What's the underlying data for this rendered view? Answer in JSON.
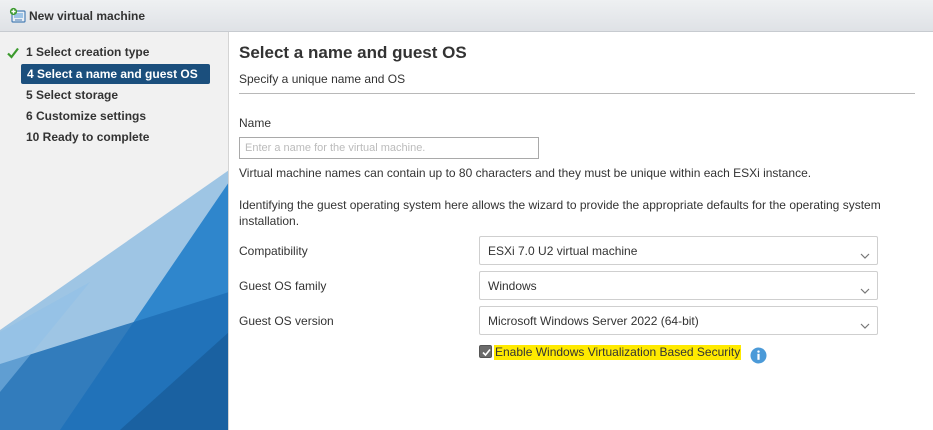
{
  "window": {
    "title": "New virtual machine",
    "icon": "vm-add-icon"
  },
  "steps": [
    {
      "label": "1  Select creation type",
      "state": "done"
    },
    {
      "label": "4  Select a name and guest OS",
      "state": "active"
    },
    {
      "label": "5  Select storage",
      "state": "pending"
    },
    {
      "label": "6  Customize settings",
      "state": "pending"
    },
    {
      "label": "10  Ready to complete",
      "state": "pending"
    }
  ],
  "main": {
    "title": "Select a name and guest OS",
    "subtitle": "Specify a unique name and OS",
    "name_label": "Name",
    "name_placeholder": "Enter a name for the virtual machine.",
    "name_value": "",
    "name_help": "Virtual machine names can contain up to 80 characters and they must be unique within each ESXi instance.",
    "os_help": "Identifying the guest operating system here allows the wizard to provide the appropriate defaults for the operating system installation.",
    "compatibility_label": "Compatibility",
    "compatibility_value": "ESXi 7.0 U2 virtual machine",
    "os_family_label": "Guest OS family",
    "os_family_value": "Windows",
    "os_version_label": "Guest OS version",
    "os_version_value": "Microsoft Windows Server 2022 (64-bit)",
    "vbs_label": "Enable Windows Virtualization Based Security",
    "vbs_checked": true
  },
  "colors": {
    "active_step": "#1b4f7d",
    "highlight": "#ffea00",
    "check_green": "#3c9a2e",
    "info_blue": "#4b9ad8"
  }
}
